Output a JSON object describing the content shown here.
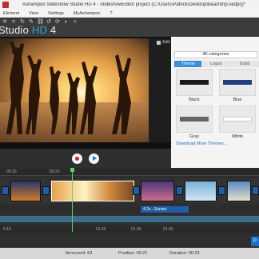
{
  "window": {
    "title": "Ashampoo Slideshow Studio HD 4 - SlideshowEditor project (C:\\Users\\Patrick\\Desktop\\beachtrip.sedprj)*"
  },
  "menu": [
    "Element",
    "View",
    "Settings",
    "MyAshampoo",
    "?"
  ],
  "toolbar": {
    "brand_prefix": "Studio ",
    "brand_hd": "HD",
    "brand_suffix": " 4",
    "tools": [
      "close-icon",
      "crop-icon",
      "rotate-icon",
      "magic-icon",
      "link-icon",
      "rotate-ccw-icon",
      "rotate-cw-icon",
      "color-icon",
      "zoom-icon"
    ]
  },
  "preview": {
    "edit_label": "Edit"
  },
  "right_panel": {
    "category": "All categories",
    "tabs": [
      "Theme",
      "Logos",
      "Subti"
    ],
    "active_tab": 0,
    "themes": [
      {
        "label": "Black",
        "bar_color": "#1a1a1a"
      },
      {
        "label": "Blue",
        "bar_color": "#1f3f7a"
      },
      {
        "label": "Gray",
        "bar_color": "#666666"
      },
      {
        "label": "White",
        "bar_color": "#ffffff"
      }
    ],
    "download_link": "Download More Themes..."
  },
  "timeline": {
    "ruler_ticks": [
      "00:10",
      "00:20"
    ],
    "bottom_ticks": [
      "0:10",
      "01:20",
      "01:30",
      "01:40"
    ],
    "text_clip": "4.2s - Sunset"
  },
  "status": {
    "itemcount": "Itemcount: 63",
    "position": "Position: 00:21",
    "duration": "Duration: 06:23"
  },
  "colors": {
    "accent": "#29a9e1",
    "tab_active": "#3b8ed6",
    "playhead": "#5cd85c",
    "transition": "#1e5fa8"
  }
}
